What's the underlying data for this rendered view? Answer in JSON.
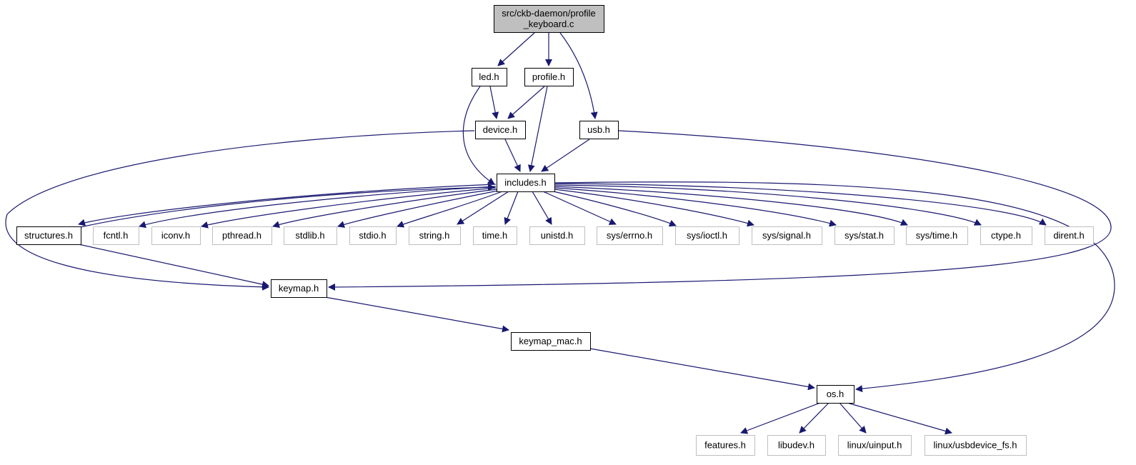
{
  "graph": {
    "nodes": [
      {
        "id": "root",
        "lines": [
          "src/ckb-daemon/profile",
          "_keyboard.c"
        ],
        "kind": "root"
      },
      {
        "id": "led",
        "lines": [
          "led.h"
        ],
        "kind": "documented"
      },
      {
        "id": "profile",
        "lines": [
          "profile.h"
        ],
        "kind": "documented"
      },
      {
        "id": "usb",
        "lines": [
          "usb.h"
        ],
        "kind": "documented"
      },
      {
        "id": "device",
        "lines": [
          "device.h"
        ],
        "kind": "documented"
      },
      {
        "id": "includes",
        "lines": [
          "includes.h"
        ],
        "kind": "documented"
      },
      {
        "id": "structures",
        "lines": [
          "structures.h"
        ],
        "kind": "documented"
      },
      {
        "id": "fcntl",
        "lines": [
          "fcntl.h"
        ],
        "kind": "system"
      },
      {
        "id": "iconv",
        "lines": [
          "iconv.h"
        ],
        "kind": "system"
      },
      {
        "id": "pthread",
        "lines": [
          "pthread.h"
        ],
        "kind": "system"
      },
      {
        "id": "stdlib",
        "lines": [
          "stdlib.h"
        ],
        "kind": "system"
      },
      {
        "id": "stdio",
        "lines": [
          "stdio.h"
        ],
        "kind": "system"
      },
      {
        "id": "string",
        "lines": [
          "string.h"
        ],
        "kind": "system"
      },
      {
        "id": "time",
        "lines": [
          "time.h"
        ],
        "kind": "system"
      },
      {
        "id": "unistd",
        "lines": [
          "unistd.h"
        ],
        "kind": "system"
      },
      {
        "id": "syserrno",
        "lines": [
          "sys/errno.h"
        ],
        "kind": "system"
      },
      {
        "id": "sysioctl",
        "lines": [
          "sys/ioctl.h"
        ],
        "kind": "system"
      },
      {
        "id": "syssignal",
        "lines": [
          "sys/signal.h"
        ],
        "kind": "system"
      },
      {
        "id": "sysstat",
        "lines": [
          "sys/stat.h"
        ],
        "kind": "system"
      },
      {
        "id": "systime",
        "lines": [
          "sys/time.h"
        ],
        "kind": "system"
      },
      {
        "id": "ctype",
        "lines": [
          "ctype.h"
        ],
        "kind": "system"
      },
      {
        "id": "dirent",
        "lines": [
          "dirent.h"
        ],
        "kind": "system"
      },
      {
        "id": "keymap",
        "lines": [
          "keymap.h"
        ],
        "kind": "documented"
      },
      {
        "id": "keymapmac",
        "lines": [
          "keymap_mac.h"
        ],
        "kind": "documented"
      },
      {
        "id": "os",
        "lines": [
          "os.h"
        ],
        "kind": "documented"
      },
      {
        "id": "features",
        "lines": [
          "features.h"
        ],
        "kind": "system"
      },
      {
        "id": "libudev",
        "lines": [
          "libudev.h"
        ],
        "kind": "system"
      },
      {
        "id": "linuxuinput",
        "lines": [
          "linux/uinput.h"
        ],
        "kind": "system"
      },
      {
        "id": "linuxusbdevice",
        "lines": [
          "linux/usbdevice_fs.h"
        ],
        "kind": "system"
      }
    ],
    "edges": [
      [
        "root",
        "led"
      ],
      [
        "root",
        "profile"
      ],
      [
        "root",
        "usb"
      ],
      [
        "led",
        "device"
      ],
      [
        "led",
        "includes"
      ],
      [
        "profile",
        "device"
      ],
      [
        "profile",
        "includes"
      ],
      [
        "device",
        "includes"
      ],
      [
        "device",
        "keymap"
      ],
      [
        "usb",
        "includes"
      ],
      [
        "usb",
        "keymap"
      ],
      [
        "includes",
        "structures"
      ],
      [
        "includes",
        "fcntl"
      ],
      [
        "includes",
        "iconv"
      ],
      [
        "includes",
        "pthread"
      ],
      [
        "includes",
        "stdlib"
      ],
      [
        "includes",
        "stdio"
      ],
      [
        "includes",
        "string"
      ],
      [
        "includes",
        "time"
      ],
      [
        "includes",
        "unistd"
      ],
      [
        "includes",
        "syserrno"
      ],
      [
        "includes",
        "sysioctl"
      ],
      [
        "includes",
        "syssignal"
      ],
      [
        "includes",
        "sysstat"
      ],
      [
        "includes",
        "systime"
      ],
      [
        "includes",
        "ctype"
      ],
      [
        "includes",
        "dirent"
      ],
      [
        "includes",
        "os"
      ],
      [
        "structures",
        "includes"
      ],
      [
        "structures",
        "keymap"
      ],
      [
        "keymap",
        "keymapmac"
      ],
      [
        "keymapmac",
        "os"
      ],
      [
        "os",
        "features"
      ],
      [
        "os",
        "libudev"
      ],
      [
        "os",
        "linuxuinput"
      ],
      [
        "os",
        "linuxusbdevice"
      ]
    ]
  },
  "colors": {
    "edge": "#191970",
    "root_fill": "#bfbfbf",
    "documented_border": "#000000",
    "system_border": "#bfbfbf",
    "text": "#000000",
    "system_text": "#000000"
  }
}
